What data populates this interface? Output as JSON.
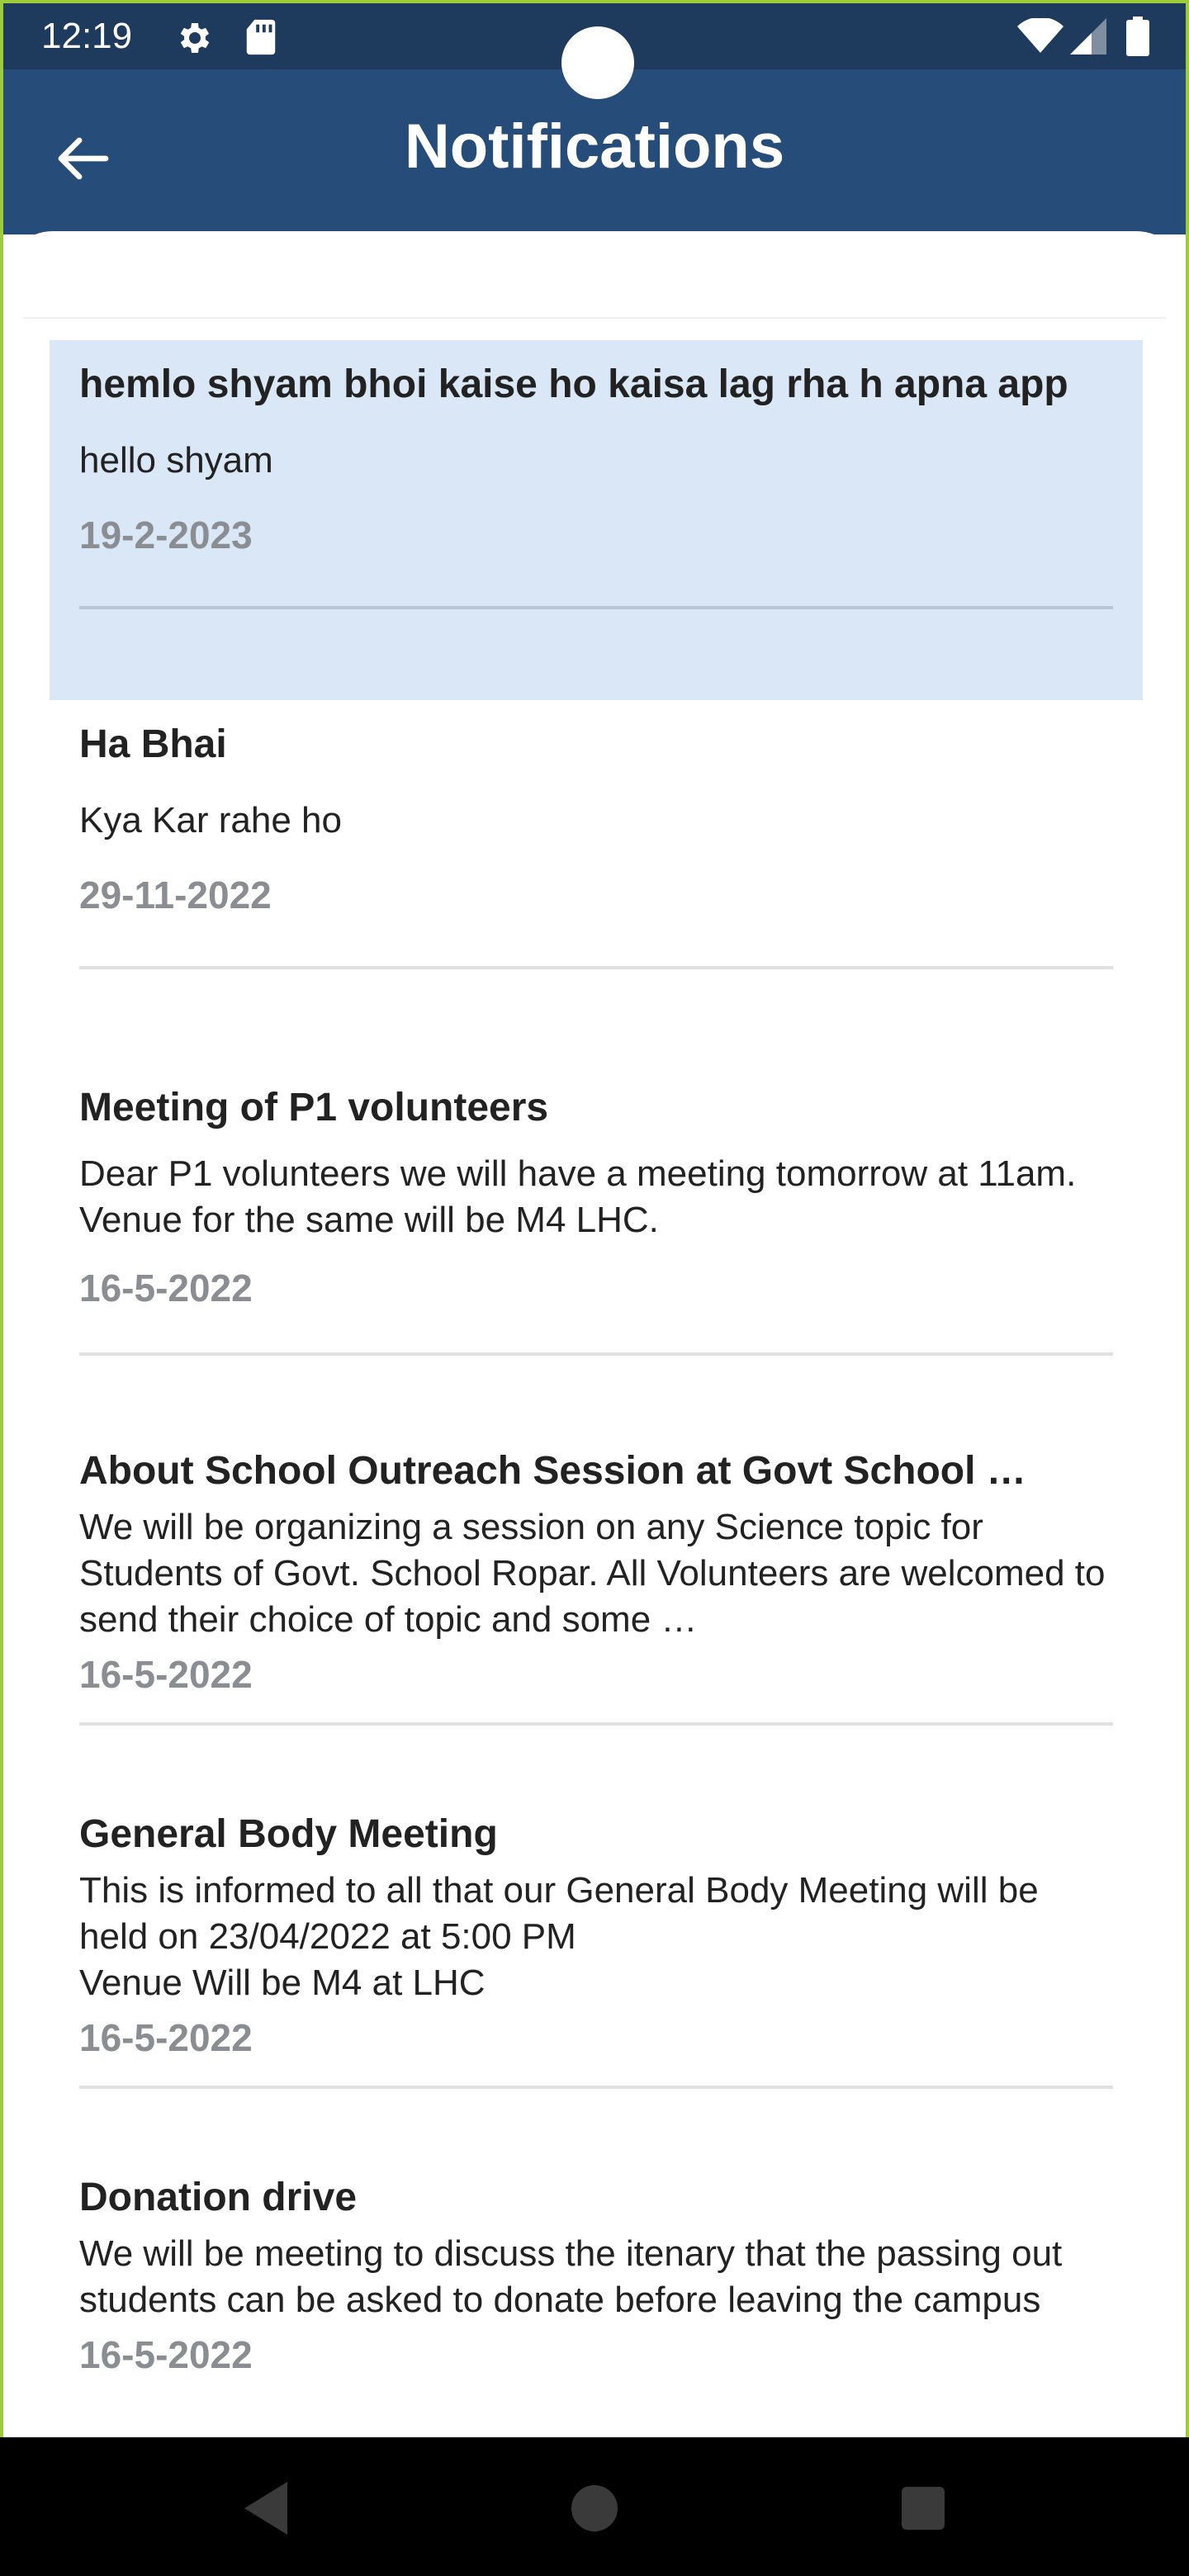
{
  "status_bar": {
    "time": "12:19",
    "icons": [
      "gear-icon",
      "sd-card-icon",
      "wifi-icon",
      "signal-icon",
      "battery-icon"
    ]
  },
  "app_bar": {
    "title": "Notifications",
    "back_icon": "arrow-left-icon",
    "color": "#264d7a"
  },
  "notifications": [
    {
      "title": "hemlo shyam bhoi kaise ho kaisa lag rha h apna app",
      "body": "hello shyam",
      "date": "19-2-2023",
      "highlighted": true
    },
    {
      "title": "Ha Bhai",
      "body": "Kya Kar rahe ho",
      "date": "29-11-2022"
    },
    {
      "title": "Meeting of P1 volunteers",
      "body": "Dear P1 volunteers we will have a meeting tomorrow at 11am. Venue for the same will be M4 LHC.",
      "date": "16-5-2022"
    },
    {
      "title": "About School Outreach Session at Govt School …",
      "body": "We will be organizing a session on any Science topic for Students of Govt. School Ropar. All Volunteers are welcomed to send their choice of topic and some …",
      "date": "16-5-2022"
    },
    {
      "title": "General Body Meeting",
      "body": "This is informed to all that our General Body Meeting will be held on 23/04/2022 at 5:00 PM\nVenue Will be M4 at LHC",
      "date": "16-5-2022"
    },
    {
      "title": "Donation drive",
      "body": "We will be meeting to discuss the itenary that the passing out students can be asked to donate before leaving the campus",
      "date": "16-5-2022"
    }
  ],
  "nav_bar": {
    "icons": [
      "back-triangle-icon",
      "home-circle-icon",
      "recents-square-icon"
    ]
  },
  "colors": {
    "highlight": "#d9e7f7",
    "date": "#8a8e93",
    "status_bar": "#1e3a5c"
  }
}
